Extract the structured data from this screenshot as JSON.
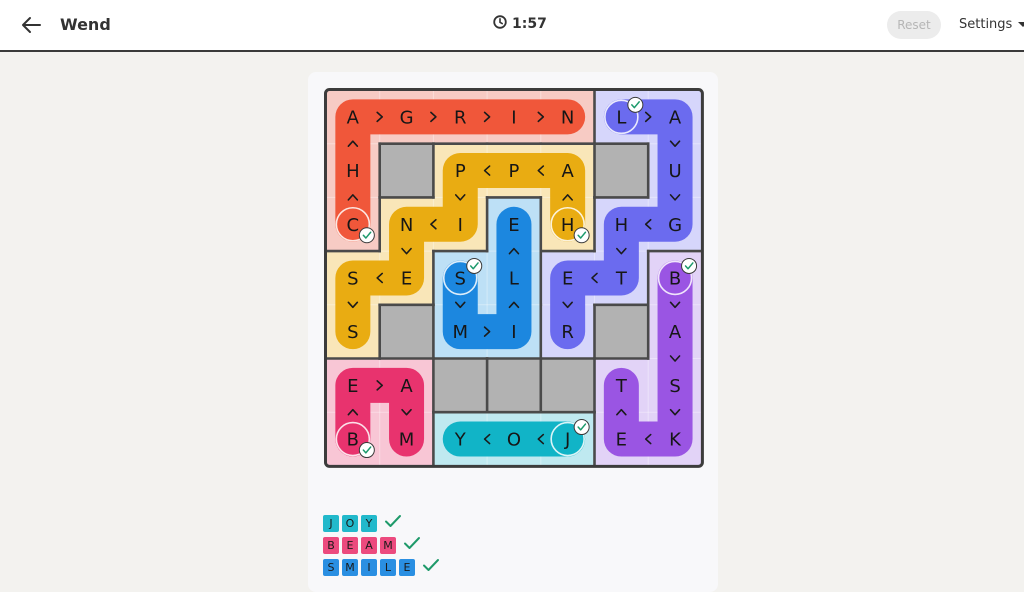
{
  "header": {
    "title": "Wend",
    "timer": "1:57",
    "reset_label": "Reset",
    "settings_label": "Settings"
  },
  "board": {
    "rows": 7,
    "cols": 7,
    "regions": [
      {
        "color": "#f7cbc4",
        "cells": [
          [
            0,
            0
          ],
          [
            0,
            1
          ],
          [
            0,
            2
          ],
          [
            0,
            3
          ],
          [
            0,
            4
          ],
          [
            1,
            0
          ],
          [
            2,
            0
          ]
        ]
      },
      {
        "color": "#d6d6fb",
        "cells": [
          [
            0,
            5
          ],
          [
            0,
            6
          ],
          [
            1,
            6
          ],
          [
            2,
            6
          ],
          [
            2,
            5
          ],
          [
            3,
            5
          ],
          [
            3,
            4
          ],
          [
            4,
            4
          ]
        ]
      },
      {
        "color": "#f9e6b8",
        "cells": [
          [
            1,
            2
          ],
          [
            1,
            3
          ],
          [
            1,
            4
          ],
          [
            2,
            2
          ],
          [
            2,
            1
          ],
          [
            2,
            4
          ],
          [
            3,
            1
          ],
          [
            3,
            0
          ],
          [
            4,
            0
          ]
        ]
      },
      {
        "color": "#bde0f6",
        "cells": [
          [
            2,
            3
          ],
          [
            3,
            3
          ],
          [
            4,
            3
          ],
          [
            3,
            2
          ],
          [
            4,
            2
          ]
        ]
      },
      {
        "color": "#e2d3f7",
        "cells": [
          [
            3,
            6
          ],
          [
            4,
            6
          ],
          [
            5,
            6
          ],
          [
            6,
            6
          ],
          [
            6,
            5
          ],
          [
            5,
            5
          ]
        ]
      },
      {
        "color": "#f8c6d5",
        "cells": [
          [
            5,
            0
          ],
          [
            5,
            1
          ],
          [
            6,
            1
          ],
          [
            6,
            0
          ]
        ]
      },
      {
        "color": "#bfe9f0",
        "cells": [
          [
            6,
            2
          ],
          [
            6,
            3
          ],
          [
            6,
            4
          ]
        ]
      }
    ],
    "blocked": [
      [
        1,
        1
      ],
      [
        1,
        5
      ],
      [
        4,
        1
      ],
      [
        4,
        5
      ],
      [
        5,
        2
      ],
      [
        5,
        3
      ],
      [
        5,
        4
      ]
    ],
    "letters": [
      [
        "A",
        "G",
        "R",
        "I",
        "N",
        "L",
        "A"
      ],
      [
        "H",
        "",
        "P",
        "P",
        "A",
        "",
        "U"
      ],
      [
        "C",
        "N",
        "I",
        "E",
        "H",
        "H",
        "G"
      ],
      [
        "S",
        "E",
        "S",
        "L",
        "E",
        "T",
        "B"
      ],
      [
        "S",
        "",
        "M",
        "I",
        "R",
        "",
        "A"
      ],
      [
        "E",
        "A",
        "",
        "",
        "",
        "T",
        "S"
      ],
      [
        "B",
        "M",
        "Y",
        "O",
        "J",
        "E",
        "K"
      ]
    ],
    "paths": [
      {
        "word": "CHAGRIN",
        "color": "#f0573a",
        "cells": [
          [
            2,
            0
          ],
          [
            1,
            0
          ],
          [
            0,
            0
          ],
          [
            0,
            1
          ],
          [
            0,
            2
          ],
          [
            0,
            3
          ],
          [
            0,
            4
          ]
        ]
      },
      {
        "word": "LAUGHTER",
        "color": "#6b6bef",
        "cells": [
          [
            0,
            5
          ],
          [
            0,
            6
          ],
          [
            1,
            6
          ],
          [
            2,
            6
          ],
          [
            2,
            5
          ],
          [
            3,
            5
          ],
          [
            3,
            4
          ],
          [
            4,
            4
          ]
        ]
      },
      {
        "word": "HAPPINESS",
        "color": "#e9ac12",
        "cells": [
          [
            2,
            4
          ],
          [
            1,
            4
          ],
          [
            1,
            3
          ],
          [
            1,
            2
          ],
          [
            2,
            2
          ],
          [
            2,
            1
          ],
          [
            3,
            1
          ],
          [
            3,
            0
          ],
          [
            4,
            0
          ]
        ]
      },
      {
        "word": "SMILE",
        "color": "#1c87df",
        "cells": [
          [
            3,
            2
          ],
          [
            4,
            2
          ],
          [
            4,
            3
          ],
          [
            3,
            3
          ],
          [
            2,
            3
          ]
        ]
      },
      {
        "word": "BASKET",
        "color": "#9a55e3",
        "cells": [
          [
            3,
            6
          ],
          [
            4,
            6
          ],
          [
            5,
            6
          ],
          [
            6,
            6
          ],
          [
            6,
            5
          ],
          [
            5,
            5
          ]
        ]
      },
      {
        "word": "BEAM",
        "color": "#e8336e",
        "cells": [
          [
            6,
            0
          ],
          [
            5,
            0
          ],
          [
            5,
            1
          ],
          [
            6,
            1
          ]
        ]
      },
      {
        "word": "JOY",
        "color": "#11b4c7",
        "cells": [
          [
            6,
            4
          ],
          [
            6,
            3
          ],
          [
            6,
            2
          ]
        ]
      }
    ]
  },
  "found_words": [
    {
      "letters": [
        "J",
        "O",
        "Y"
      ],
      "color": "#22b9cb"
    },
    {
      "letters": [
        "B",
        "E",
        "A",
        "M"
      ],
      "color": "#ec4a7e"
    },
    {
      "letters": [
        "S",
        "M",
        "I",
        "L",
        "E"
      ],
      "color": "#2a8fe2"
    }
  ]
}
